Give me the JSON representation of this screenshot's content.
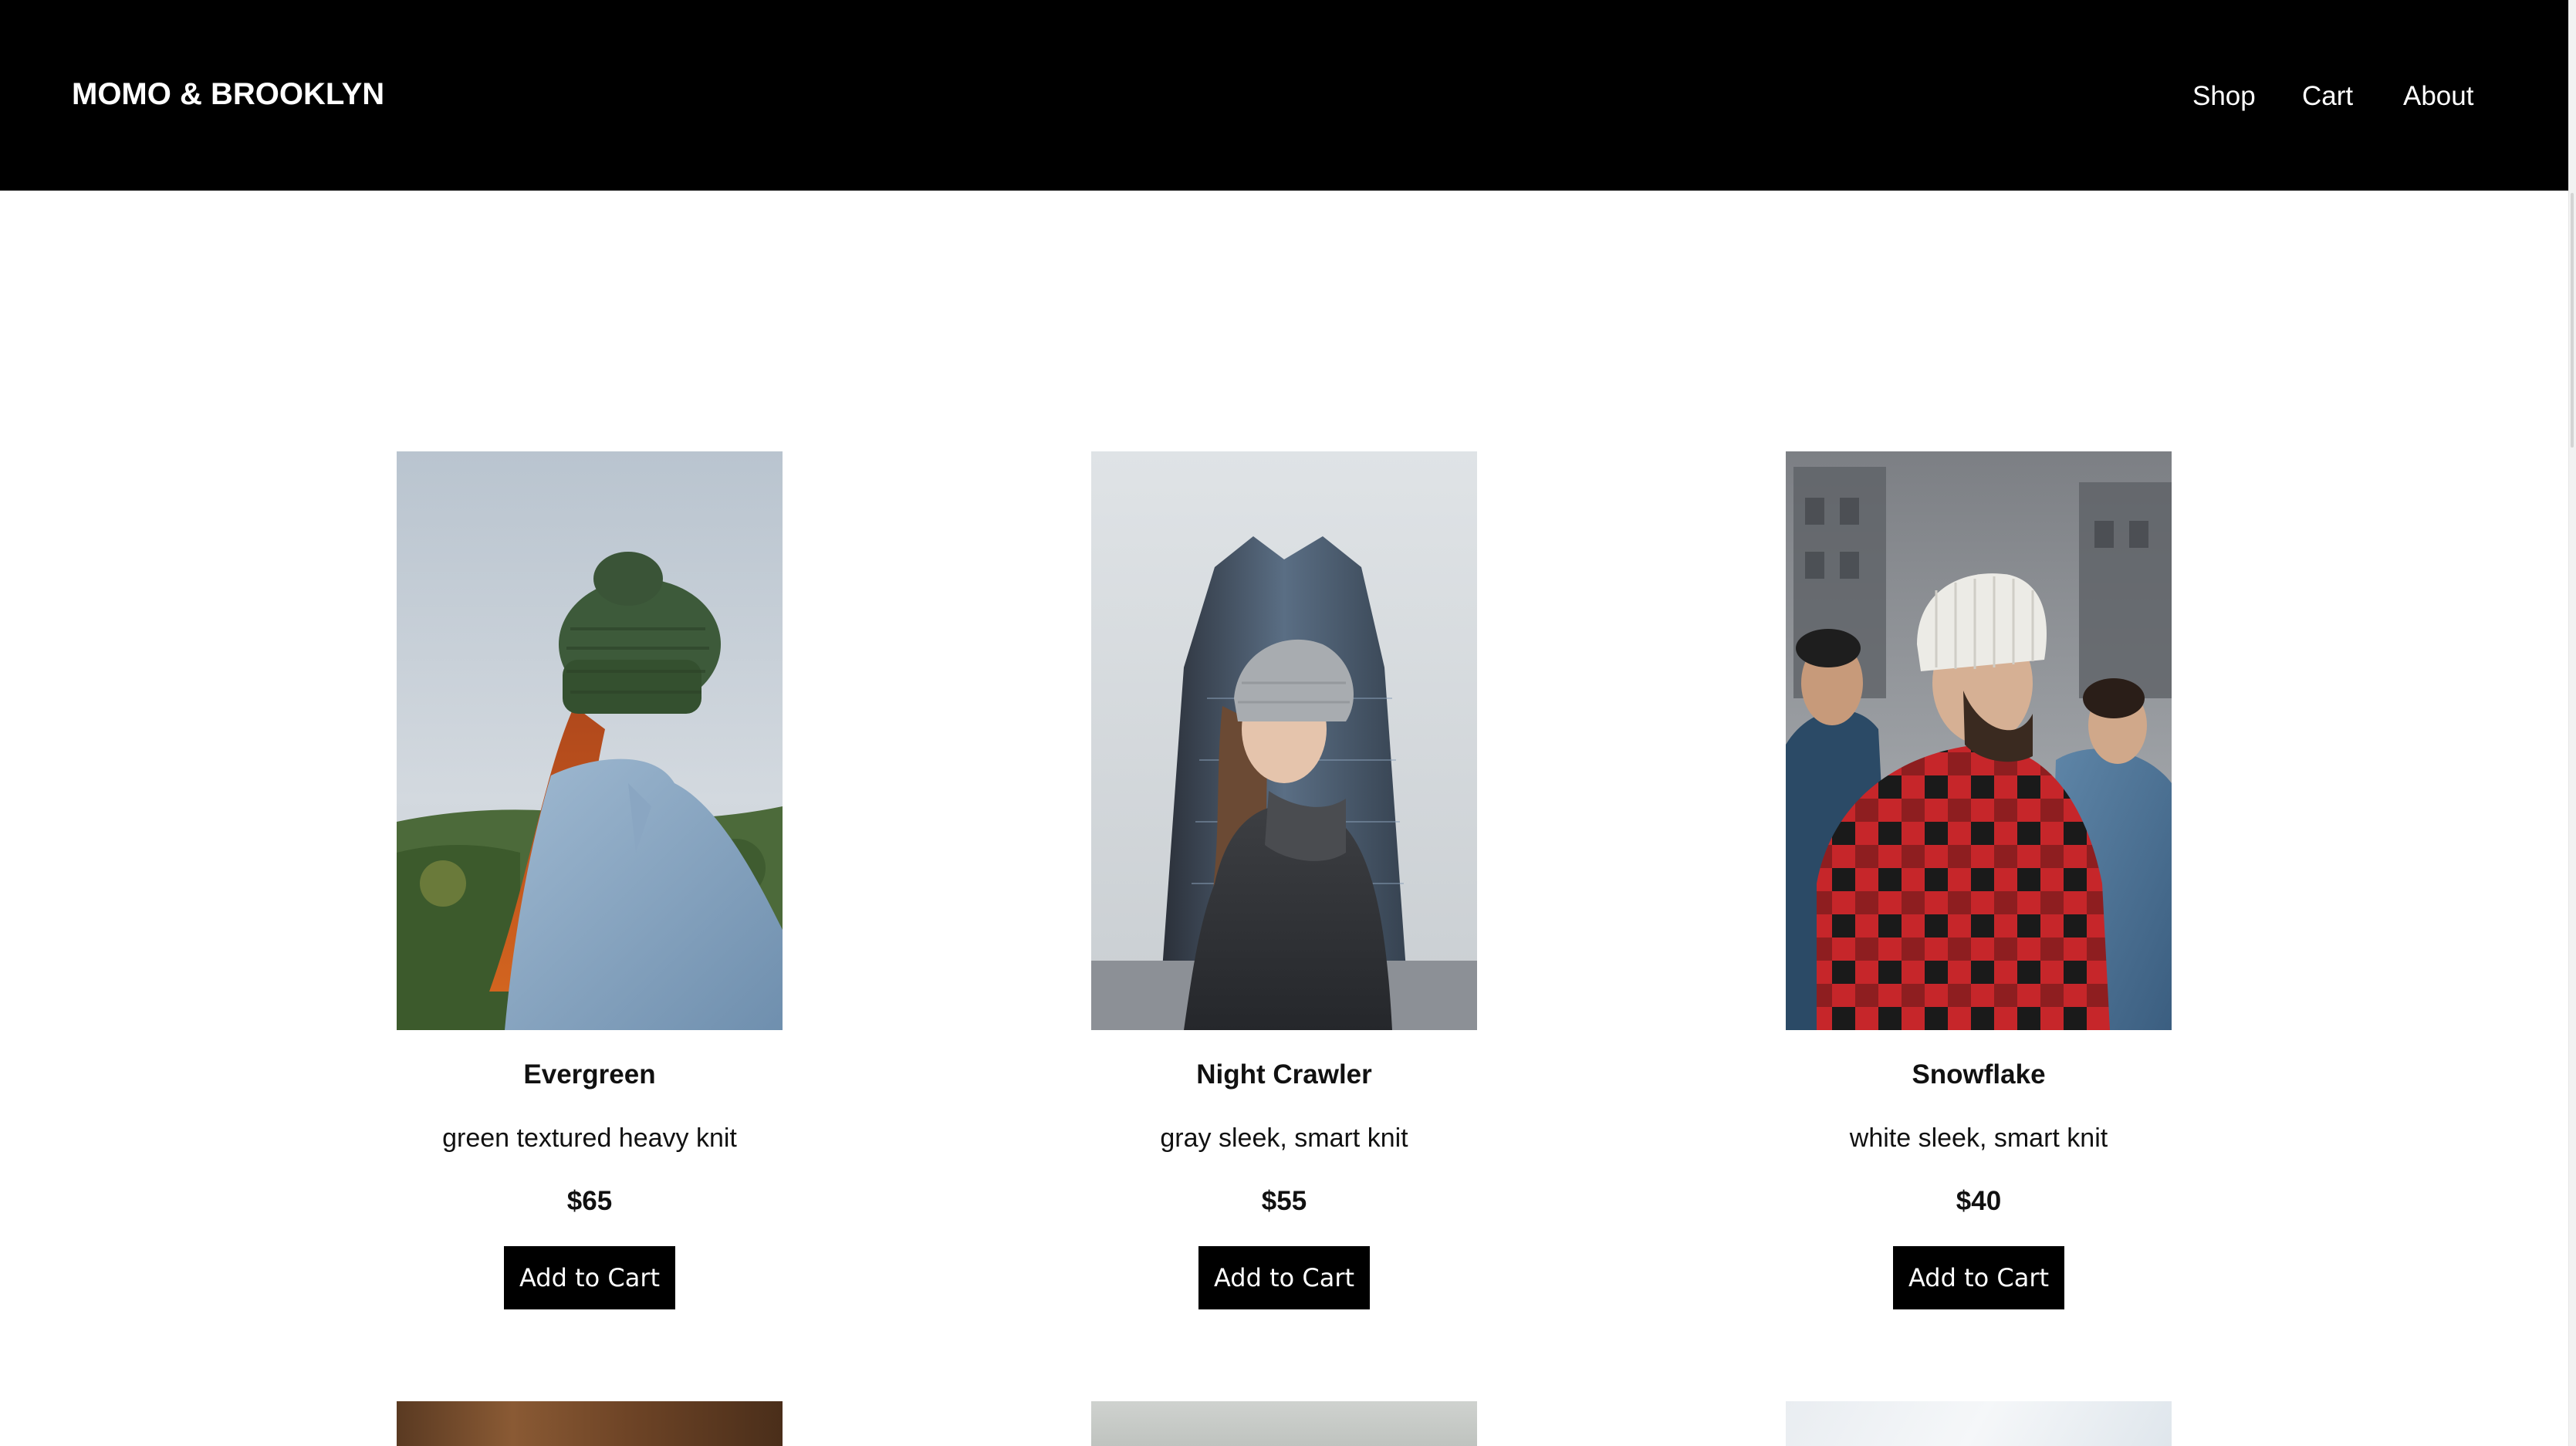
{
  "header": {
    "brand": "MOMO & BROOKLYN",
    "nav": [
      {
        "label": "Shop"
      },
      {
        "label": "Cart"
      },
      {
        "label": "About"
      }
    ]
  },
  "products": [
    {
      "name": "Evergreen",
      "description": "green textured heavy knit",
      "price": "$65",
      "button_label": "Add to Cart",
      "image": "woman-green-beanie-photo"
    },
    {
      "name": "Night Crawler",
      "description": "gray sleek, smart knit",
      "price": "$55",
      "button_label": "Add to Cart",
      "image": "woman-gray-beanie-photo"
    },
    {
      "name": "Snowflake",
      "description": "white sleek, smart knit",
      "price": "$40",
      "button_label": "Add to Cart",
      "image": "man-white-beanie-photo"
    }
  ],
  "colors": {
    "header_bg": "#000000",
    "header_text": "#ffffff",
    "button_bg": "#000000",
    "button_text": "#ffffff",
    "page_bg": "#ffffff"
  }
}
